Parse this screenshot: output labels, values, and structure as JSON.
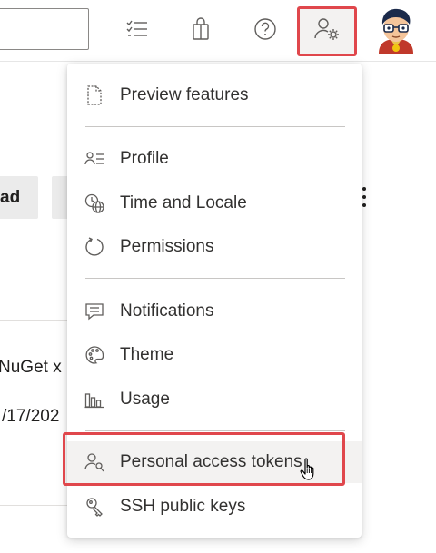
{
  "menu": {
    "items": [
      {
        "label": "Preview features",
        "icon": "preview-features-icon"
      },
      {
        "label": "Profile",
        "icon": "profile-icon"
      },
      {
        "label": "Time and Locale",
        "icon": "time-locale-icon"
      },
      {
        "label": "Permissions",
        "icon": "permissions-icon"
      },
      {
        "label": "Notifications",
        "icon": "notifications-icon"
      },
      {
        "label": "Theme",
        "icon": "theme-icon"
      },
      {
        "label": "Usage",
        "icon": "usage-icon"
      },
      {
        "label": "Personal access tokens",
        "icon": "personal-access-tokens-icon"
      },
      {
        "label": "SSH public keys",
        "icon": "ssh-keys-icon"
      }
    ]
  },
  "background": {
    "button_label": "ad",
    "text_nuget": "NuGet x",
    "text_date": "/17/202"
  },
  "colors": {
    "highlight_border": "#e0474c",
    "hover_bg": "#f3f2f1",
    "text": "#323130"
  }
}
